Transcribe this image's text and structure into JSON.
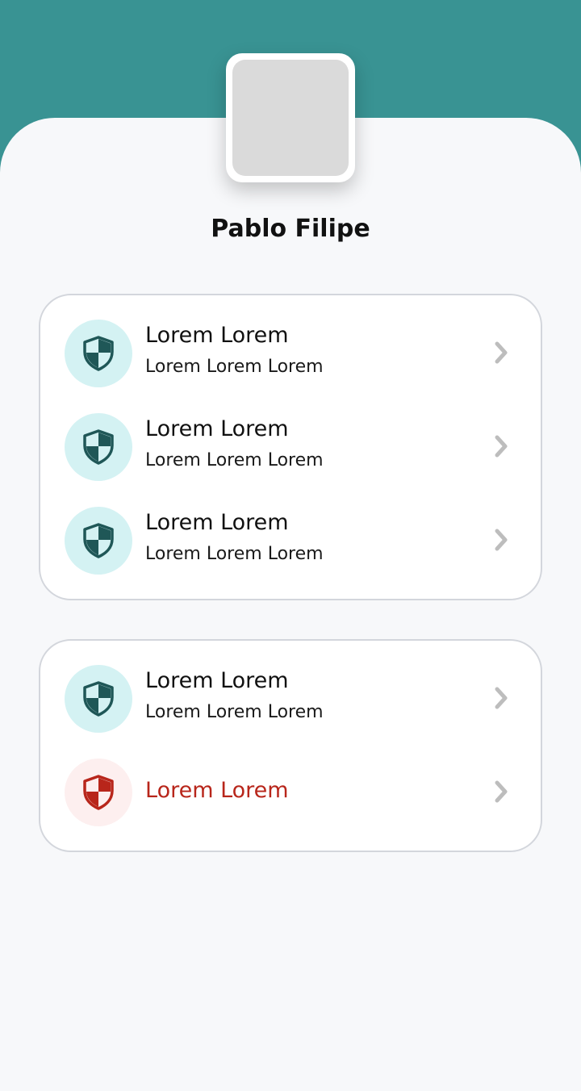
{
  "profile": {
    "name": "Pablo Filipe"
  },
  "colors": {
    "header": "#399393",
    "background": "#f7f8fa",
    "icon_circle": "#d4f2f3",
    "icon_shield": "#1f5757",
    "danger_circle": "#fdefef",
    "danger": "#b8261b",
    "chevron": "#bdbdbd"
  },
  "sections": [
    {
      "items": [
        {
          "icon": "shield-icon",
          "title": "Lorem Lorem",
          "subtitle": "Lorem Lorem  Lorem"
        },
        {
          "icon": "shield-icon",
          "title": "Lorem Lorem",
          "subtitle": "Lorem Lorem  Lorem"
        },
        {
          "icon": "shield-icon",
          "title": "Lorem Lorem",
          "subtitle": "Lorem Lorem  Lorem"
        }
      ]
    },
    {
      "items": [
        {
          "icon": "shield-icon",
          "title": "Lorem Lorem",
          "subtitle": "Lorem Lorem  Lorem"
        },
        {
          "icon": "shield-icon",
          "title": "Lorem Lorem",
          "style": "danger"
        }
      ]
    }
  ]
}
